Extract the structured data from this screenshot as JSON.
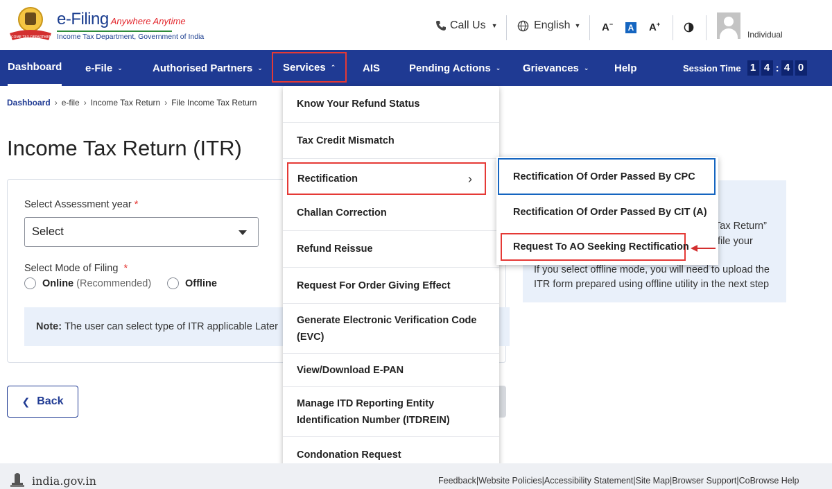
{
  "header": {
    "logo_title": "e-Filing",
    "logo_tagline": "Anywhere Anytime",
    "logo_subtitle": "Income Tax Department, Government of India",
    "call_us": "Call Us",
    "language": "English",
    "font_decrease": "A",
    "font_normal": "A",
    "font_increase": "A",
    "user_role": "Individual"
  },
  "nav": {
    "items": [
      {
        "label": "Dashboard"
      },
      {
        "label": "e-File"
      },
      {
        "label": "Authorised Partners"
      },
      {
        "label": "Services"
      },
      {
        "label": "AIS"
      },
      {
        "label": "Pending Actions"
      },
      {
        "label": "Grievances"
      },
      {
        "label": "Help"
      }
    ],
    "session_label": "Session Time",
    "session_digits": [
      "1",
      "4",
      "4",
      "0"
    ]
  },
  "breadcrumb": [
    "Dashboard",
    "e-file",
    "Income Tax Return",
    "File Income Tax Return"
  ],
  "page_title": "Income Tax Return (ITR)",
  "form": {
    "assessment_label": "Select Assessment year",
    "assessment_required": "*",
    "assessment_value": "Select",
    "mode_label": "Select Mode of Filing",
    "mode_required": "*",
    "online_label": "Online",
    "online_hint": "(Recommended)",
    "offline_label": "Offline",
    "note_prefix": "Note:",
    "note_text": "The user can select type of ITR applicable Later"
  },
  "info": {
    "line1": "Tax Return”",
    "line2": "file your",
    "line3": "If you select offline mode, you will need to upload the",
    "line4": "ITR form prepared using offline utility in the next step"
  },
  "back_button": "Back",
  "services_menu": [
    {
      "label": "Know Your Refund Status"
    },
    {
      "label": "Tax Credit Mismatch"
    },
    {
      "label": "Rectification"
    },
    {
      "label": "Challan Correction"
    },
    {
      "label": "Refund Reissue"
    },
    {
      "label": "Request For Order Giving Effect"
    },
    {
      "label": "Generate Electronic Verification Code (EVC)"
    },
    {
      "label": "View/Download E-PAN"
    },
    {
      "label": "Manage ITD Reporting Entity Identification Number (ITDREIN)"
    },
    {
      "label": "Condonation Request"
    }
  ],
  "rectification_submenu": [
    {
      "label": "Rectification Of Order Passed By CPC"
    },
    {
      "label": "Rectification Of Order Passed By CIT (A)"
    },
    {
      "label": "Request To AO Seeking Rectification"
    }
  ],
  "footer": {
    "india_logo": "india.gov.in",
    "links": [
      "Feedback",
      "|Website Policies",
      "|Accessibility Statement",
      "|Site Map",
      "|Browser Support",
      "|CoBrowse Help"
    ]
  },
  "colors": {
    "nav_bg": "#1f3a93",
    "highlight_red": "#e53935",
    "highlight_blue": "#1565c0"
  }
}
